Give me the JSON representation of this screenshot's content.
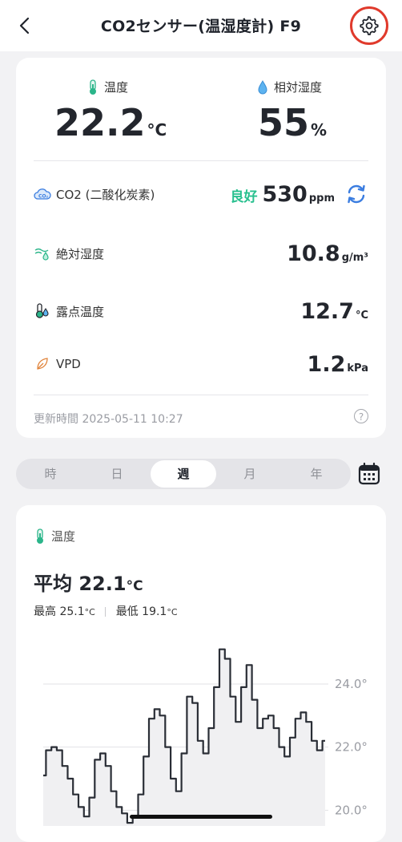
{
  "header": {
    "title": "CO2センサー(温湿度計) F9"
  },
  "summary": {
    "temperature": {
      "label": "温度",
      "value": "22.2",
      "unit": "°C"
    },
    "humidity": {
      "label": "相対湿度",
      "value": "55",
      "unit": "%"
    }
  },
  "metrics": [
    {
      "label": "CO2 (二酸化炭素)",
      "status": "良好",
      "value": "530",
      "unit": "ppm"
    },
    {
      "label": "絶対湿度",
      "value": "10.8",
      "unit": "g/m³"
    },
    {
      "label": "露点温度",
      "value": "12.7",
      "unit": "°C"
    },
    {
      "label": "VPD",
      "value": "1.2",
      "unit": "kPa"
    }
  ],
  "updated": "更新時間 2025-05-11 10:27",
  "help_label": "?",
  "periods": [
    "時",
    "日",
    "週",
    "月",
    "年"
  ],
  "selected_period": "週",
  "chart_card": {
    "label": "温度",
    "avg_label": "平均",
    "avg_value": "22.1",
    "unit": "°C",
    "max_label": "最高",
    "max_value": "25.1",
    "min_label": "最低",
    "min_value": "19.1"
  },
  "chart_data": {
    "type": "line",
    "y_ticks": [
      "24.0°",
      "22.0°",
      "20.0°"
    ],
    "ylim": [
      19.5,
      25.6
    ],
    "grid": true,
    "series": [
      {
        "values": [
          21.1,
          21.9,
          22.0,
          21.9,
          21.4,
          21.0,
          20.5,
          20.1,
          19.8,
          20.4,
          21.6,
          21.8,
          21.4,
          20.6,
          20.1,
          19.9,
          19.6,
          19.8,
          20.5,
          21.7,
          22.9,
          23.2,
          23.0,
          22.0,
          21.0,
          20.6,
          21.8,
          23.6,
          23.4,
          22.2,
          21.8,
          22.6,
          23.9,
          25.1,
          24.8,
          23.6,
          22.8,
          23.9,
          24.6,
          23.5,
          22.6,
          22.9,
          23.0,
          22.6,
          22.0,
          21.7,
          22.3,
          22.9,
          23.1,
          22.8,
          22.2,
          21.9,
          22.2
        ]
      }
    ]
  },
  "colors": {
    "good": "#29c08f",
    "accent": "#3b7de0",
    "highlight": "#e03a2c",
    "line": "#2a2e36"
  }
}
